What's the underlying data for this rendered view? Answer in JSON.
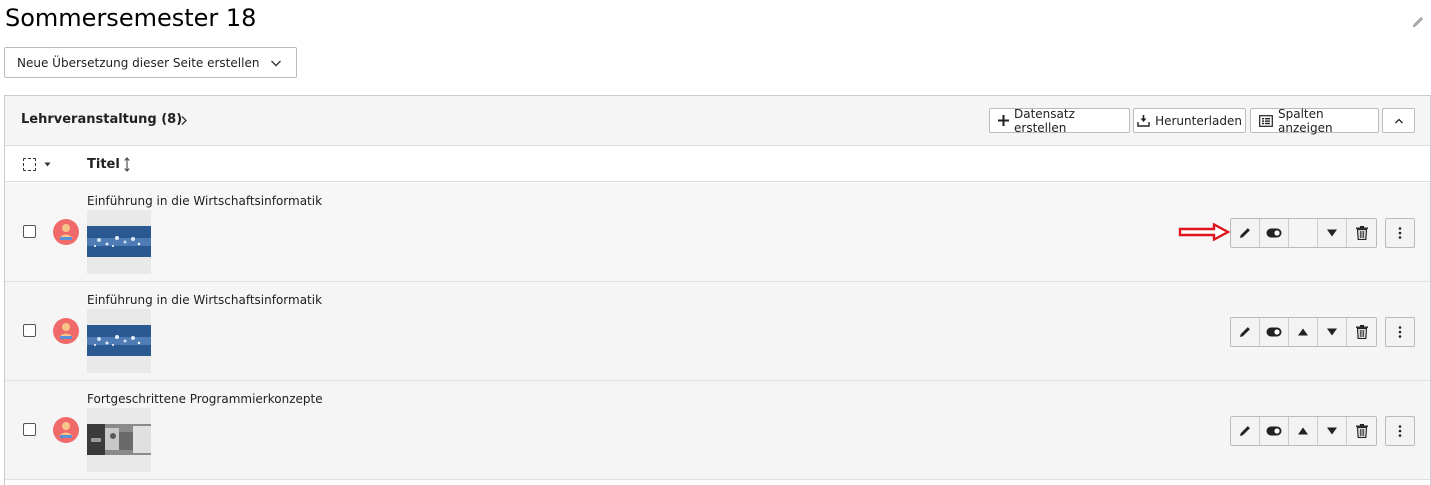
{
  "page": {
    "title": "Sommersemester 18",
    "translation_select": "Neue Übersetzung dieser Seite erstellen"
  },
  "panel": {
    "title": "Lehrveranstaltung (8)",
    "buttons": {
      "create": "Datensatz erstellen",
      "download": "Herunterladen",
      "columns": "Spalten anzeigen"
    },
    "column_title": "Titel"
  },
  "rows": [
    {
      "title": "Einführung in die Wirtschaftsinformatik"
    },
    {
      "title": "Einführung in die Wirtschaftsinformatik"
    },
    {
      "title": "Fortgeschrittene Programmierkonzepte"
    }
  ],
  "colors": {
    "annotation_arrow": "#e0141c",
    "avatar": "#f06a6a"
  }
}
